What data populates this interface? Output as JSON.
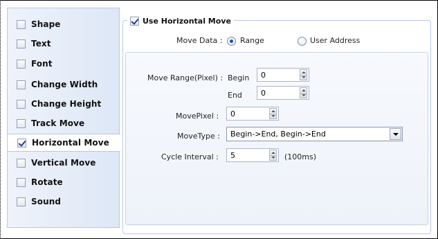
{
  "sidebar": {
    "items": [
      {
        "label": "Shape",
        "checked": false
      },
      {
        "label": "Text",
        "checked": false
      },
      {
        "label": "Font",
        "checked": false
      },
      {
        "label": "Change Width",
        "checked": false
      },
      {
        "label": "Change Height",
        "checked": false
      },
      {
        "label": "Track Move",
        "checked": false
      },
      {
        "label": "Horizontal Move",
        "checked": true,
        "selected": true
      },
      {
        "label": "Vertical Move",
        "checked": false
      },
      {
        "label": "Rotate",
        "checked": false
      },
      {
        "label": "Sound",
        "checked": false
      }
    ]
  },
  "panel": {
    "title": "Use Horizontal Move",
    "title_checked": true,
    "move_data_label": "Move Data :",
    "radio_range_label": "Range",
    "radio_user_label": "User Address",
    "selected_radio": "Range",
    "move_range_label": "Move Range(Pixel) :",
    "begin_label": "Begin",
    "begin_value": "0",
    "end_label": "End",
    "end_value": "0",
    "move_pixel_label": "MovePixel :",
    "move_pixel_value": "0",
    "move_type_label": "MoveType :",
    "move_type_value": "Begin->End, Begin->End",
    "cycle_interval_label": "Cycle Interval :",
    "cycle_interval_value": "5",
    "cycle_interval_unit": "(100ms)"
  },
  "colors": {
    "sidebar_gradient_start": "#eef3fb",
    "sidebar_gradient_end": "#dde7f6",
    "border": "#b9c8e0",
    "check_mark": "#2a3e8c",
    "radio_dot": "#1f4fb0"
  }
}
